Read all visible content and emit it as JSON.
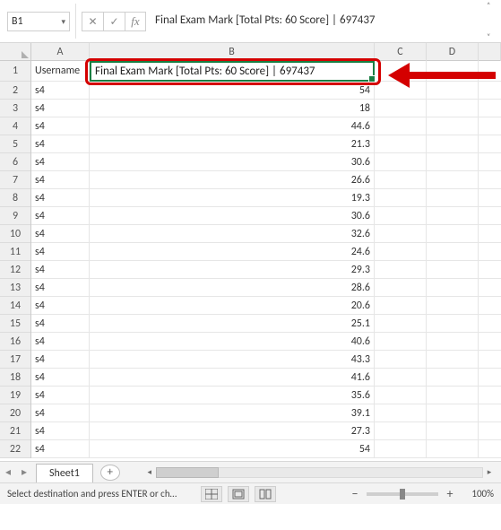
{
  "namebox": {
    "ref": "B1"
  },
  "formula_bar": {
    "content": "Final Exam Mark [Total Pts: 60 Score]  | 697437"
  },
  "columns": [
    "A",
    "B",
    "C",
    "D"
  ],
  "b1_text": "Final Exam Mark [Total Pts: 60 Score]  | 697437",
  "a1_text": "Username",
  "row_labels": [
    "1",
    "2",
    "3",
    "4",
    "5",
    "6",
    "7",
    "8",
    "9",
    "10",
    "11",
    "12",
    "13",
    "14",
    "15",
    "16",
    "17",
    "18",
    "19",
    "20",
    "21",
    "22"
  ],
  "colA_values": [
    "s4",
    "s4",
    "s4",
    "s4",
    "s4",
    "s4",
    "s4",
    "s4",
    "s4",
    "s4",
    "s4",
    "s4",
    "s4",
    "s4",
    "s4",
    "s4",
    "s4",
    "s4",
    "s4",
    "s4",
    "s4"
  ],
  "colB_values": [
    "54",
    "18",
    "44.6",
    "21.3",
    "30.6",
    "26.6",
    "19.3",
    "30.6",
    "32.6",
    "24.6",
    "29.3",
    "28.6",
    "20.6",
    "25.1",
    "40.6",
    "43.3",
    "41.6",
    "35.6",
    "39.1",
    "27.3",
    "54"
  ],
  "sheet": {
    "name": "Sheet1"
  },
  "status": {
    "message": "Select destination and press ENTER or ch…",
    "zoom": "100%"
  },
  "fx": {
    "cancel": "✕",
    "enter": "✓",
    "label": "fx"
  }
}
